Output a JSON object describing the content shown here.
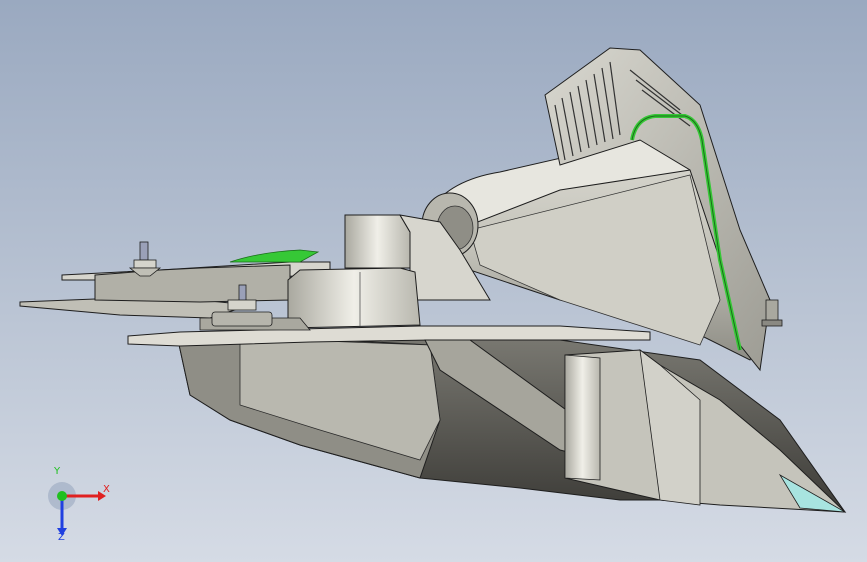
{
  "viewport": {
    "background_top": "#9aa9c0",
    "background_bottom": "#d5dbe5"
  },
  "model": {
    "body_color": "#c9c8bf",
    "shadow_color": "#8d8c84",
    "edge_color": "#1e1e1e",
    "highlight_color": "#36c836"
  },
  "triad": {
    "x_label": "X",
    "y_label": "Y",
    "z_label": "Z",
    "x_color": "#e02020",
    "y_color": "#20c020",
    "z_color": "#2040e0"
  }
}
